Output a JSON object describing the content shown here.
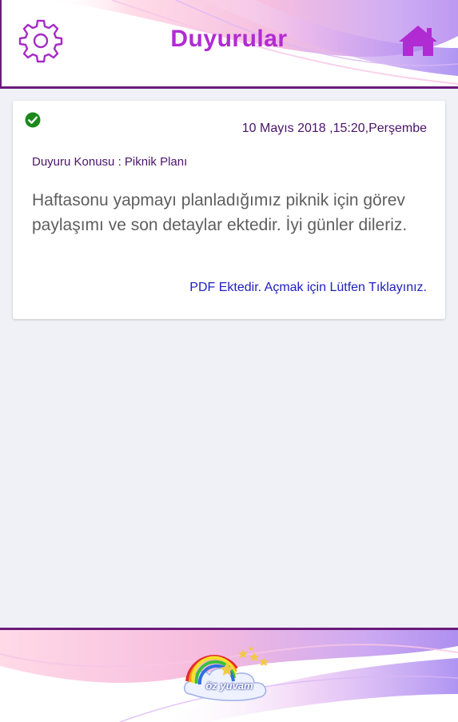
{
  "header": {
    "title": "Duyurular",
    "settings_icon": "gear-icon",
    "home_icon": "home-icon"
  },
  "announcement": {
    "status_icon": "check-circle-icon",
    "date": "10 Mayıs 2018 ,15:20,Perşembe",
    "subject": "Duyuru Konusu : Piknik Planı",
    "body": "Haftasonu yapmayı planladığımız piknik için görev paylaşımı ve son detaylar ektedir. İyi günler dileriz.",
    "pdf_link": "PDF Ektedir. Açmak için Lütfen Tıklayınız."
  },
  "footer": {
    "logo_text": "öz yuvam"
  },
  "colors": {
    "title": "#b12bd2",
    "accent": "#6a1b7a",
    "link": "#2020c0",
    "check": "#1a8a1a",
    "background": "#eff1f6"
  }
}
